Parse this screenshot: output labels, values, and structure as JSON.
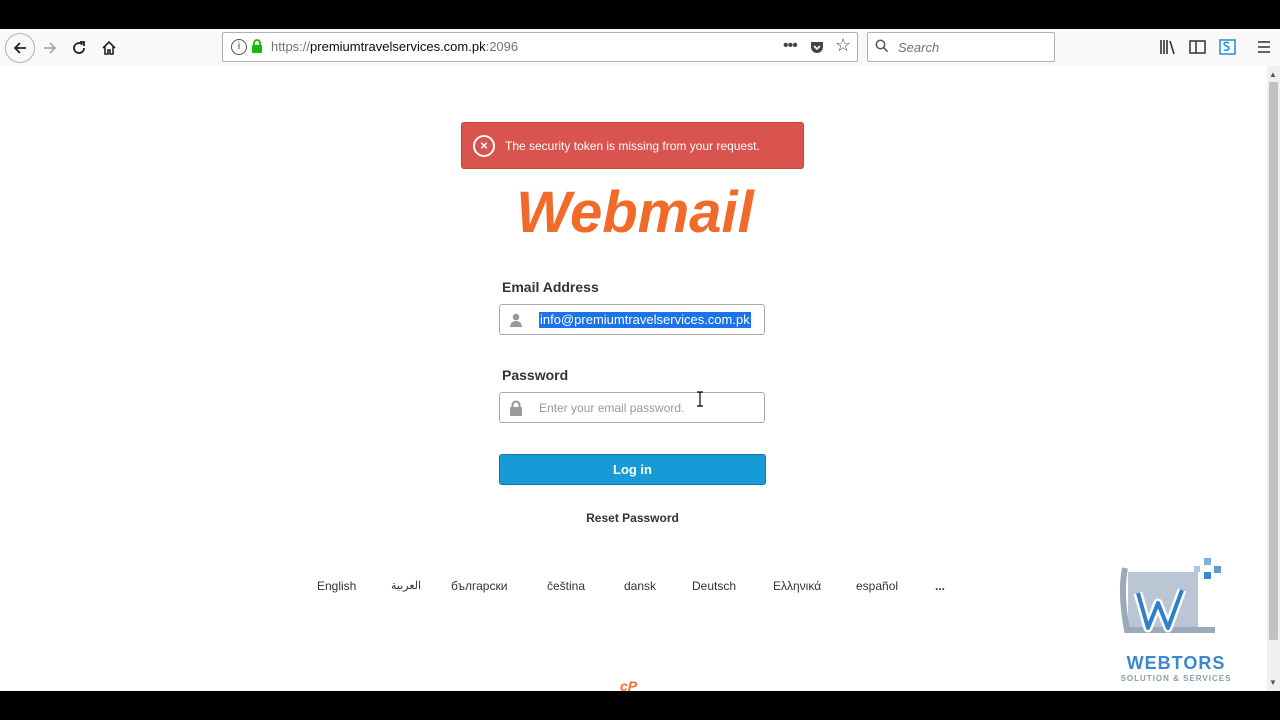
{
  "browser": {
    "url_scheme": "https://",
    "url_host": "premiumtravelservices.com.pk",
    "url_port": ":2096",
    "search_placeholder": "Search",
    "page_actions_label": "•••"
  },
  "alert": {
    "icon": "×",
    "message": "The security token is missing from your request."
  },
  "logo": {
    "text": "Webmail",
    "color": "#f06a2a"
  },
  "form": {
    "email_label": "Email Address",
    "email_value": "info@premiumtravelservices.com.pk",
    "password_label": "Password",
    "password_placeholder": "Enter your email password.",
    "login_label": "Log in",
    "reset_label": "Reset Password",
    "accent_color": "#179bd7"
  },
  "languages": [
    "English",
    "العربية",
    "български",
    "čeština",
    "dansk",
    "Deutsch",
    "Ελληνικά",
    "español",
    "..."
  ],
  "footer": {
    "cpanel_mark": "cP"
  },
  "watermark": {
    "title": "WEBTORS",
    "subtitle": "SOLUTION & SERVICES"
  }
}
